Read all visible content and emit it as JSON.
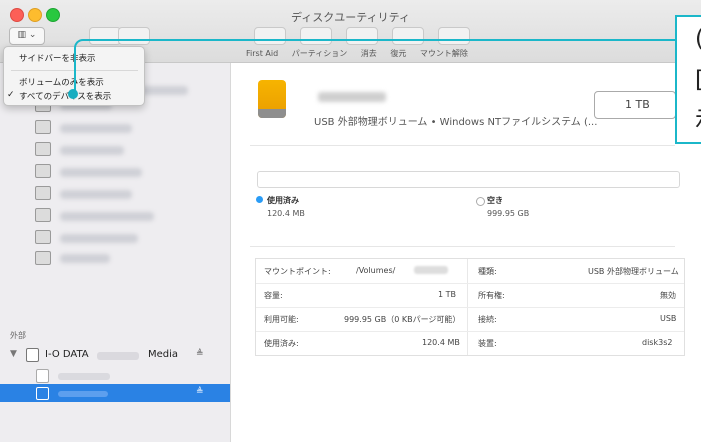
{
  "window": {
    "title": "ディスクユーティリティ"
  },
  "toolbar": {
    "sidebar_toggle": "▥ ⌄",
    "buttons": [
      "First Aid",
      "パーティション",
      "消去",
      "復元",
      "マウント解除"
    ]
  },
  "menu": {
    "items": [
      {
        "check": "",
        "label": "サイドバーを非表示"
      },
      {
        "check": "",
        "label": "ボリュームのみを表示"
      },
      {
        "check": "✓",
        "label": "すべてのデバイスを表示"
      }
    ]
  },
  "callout": {
    "lines": [
      "(",
      "[",
      "示"
    ]
  },
  "sidebar": {
    "external_heading": "外部",
    "external_disk_label": "I-O DATA",
    "external_disk_suffix": "Media",
    "eject_glyph": "≜"
  },
  "disk": {
    "description": "USB 外部物理ボリューム • Windows NTファイルシステム (...",
    "size": "1 TB",
    "used_label": "使用済み",
    "used_value": "120.4 MB",
    "free_label": "空き",
    "free_value": "999.95 GB"
  },
  "details": {
    "rows": [
      {
        "left_label": "マウントポイント:",
        "left_value": "/Volumes/",
        "right_label": "種類:",
        "right_value": "USB 外部物理ボリューム"
      },
      {
        "left_label": "容量:",
        "left_value": "1 TB",
        "right_label": "所有権:",
        "right_value": "無効"
      },
      {
        "left_label": "利用可能:",
        "left_value": "999.95 GB（0 KBパージ可能）",
        "right_label": "接続:",
        "right_value": "USB"
      },
      {
        "left_label": "使用済み:",
        "left_value": "120.4 MB",
        "right_label": "装置:",
        "right_value": "disk3s2"
      }
    ]
  },
  "colors": {
    "accent": "#2a82e4",
    "callout": "#1bb7c9",
    "disk": "#f2aa00"
  }
}
